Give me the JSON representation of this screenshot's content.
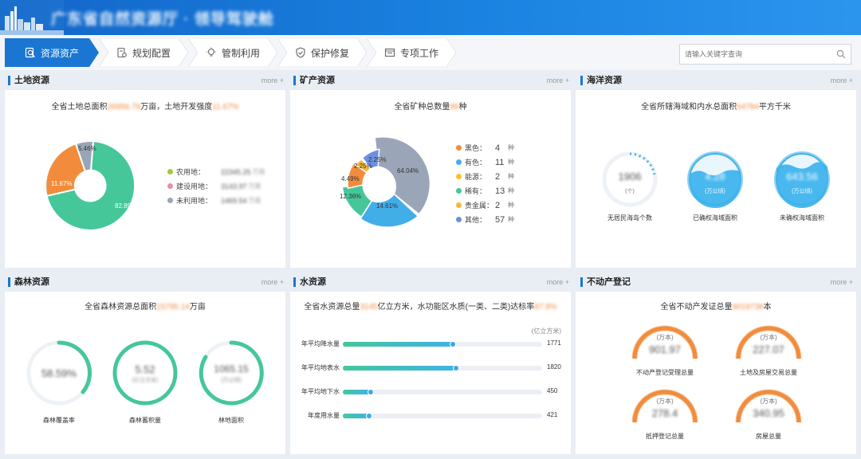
{
  "header": {
    "title": "广东省自然资源厅 · 领导驾驶舱"
  },
  "nav": {
    "tabs": [
      {
        "label": "资源资产",
        "icon": "search-doc-icon"
      },
      {
        "label": "规划配置",
        "icon": "plan-icon"
      },
      {
        "label": "管制利用",
        "icon": "bulb-icon"
      },
      {
        "label": "保护修复",
        "icon": "shield-icon"
      },
      {
        "label": "专项工作",
        "icon": "folder-icon"
      }
    ],
    "search_placeholder": "请输入关键字查询"
  },
  "more_label": "more +",
  "land": {
    "title": "土地资源",
    "summary_a": "全省土地总面积",
    "summary_v1": "26956.76",
    "summary_b": "万亩，土地开发强度",
    "summary_v2": "11.67%",
    "legend": [
      {
        "label": "农用地：",
        "value": "22345.25",
        "unit": "万亩",
        "color": "#9ccc3c"
      },
      {
        "label": "建设用地：",
        "value": "3143.97",
        "unit": "万亩",
        "color": "#e88fa0"
      },
      {
        "label": "未利用地：",
        "value": "1469.54",
        "unit": "万亩",
        "color": "#9aa5b8"
      }
    ],
    "pie_labels": [
      "82.89%",
      "11.67%",
      "5.46%"
    ]
  },
  "mineral": {
    "title": "矿产资源",
    "summary_a": "全省矿种总数量",
    "summary_v1": "89",
    "summary_b": "种",
    "legend": [
      {
        "label": "黑色：",
        "value": "4",
        "unit": "种",
        "color": "#f28c3c"
      },
      {
        "label": "有色：",
        "value": "11",
        "unit": "种",
        "color": "#42aee8"
      },
      {
        "label": "能源：",
        "value": "2",
        "unit": "种",
        "color": "#f6c22e"
      },
      {
        "label": "稀有：",
        "value": "13",
        "unit": "种",
        "color": "#45c79a"
      },
      {
        "label": "贵金属：",
        "value": "2",
        "unit": "种",
        "color": "#f3b83c"
      },
      {
        "label": "其他：",
        "value": "57",
        "unit": "种",
        "color": "#6c8fe0"
      }
    ],
    "pie_labels": [
      "64.04%",
      "14.61%",
      "12.36%",
      "4.49%",
      "2.25%",
      "2.25%"
    ]
  },
  "ocean": {
    "title": "海洋资源",
    "summary_a": "全省所辖海域和内水总面积",
    "summary_v1": "64784",
    "summary_b": "平方千米",
    "items": [
      {
        "value": "1906",
        "unit": "(个)",
        "caption": "无居民海岛个数"
      },
      {
        "value": "4.28",
        "unit": "(万公顷)",
        "caption": "已确权海域面积"
      },
      {
        "value": "643.56",
        "unit": "(万公顷)",
        "caption": "未确权海域面积"
      }
    ]
  },
  "forest": {
    "title": "森林资源",
    "summary_a": "全省森林资源总面积",
    "summary_v1": "15795.14",
    "summary_b": "万亩",
    "items": [
      {
        "value": "58.59%",
        "unit": "",
        "caption": "森林覆盖率"
      },
      {
        "value": "5.52",
        "unit": "(亿立方米)",
        "caption": "森林蓄积量"
      },
      {
        "value": "1065.15",
        "unit": "(万公顷)",
        "caption": "林地面积"
      }
    ]
  },
  "water": {
    "title": "水资源",
    "summary_a": "全省水资源总量",
    "summary_v1": "3145",
    "summary_b": "亿立方米，水功能区水质(一类、二类)达标率",
    "summary_v2": "87.9%",
    "unit_label": "(亿立方米)",
    "bars": [
      {
        "label": "年平均降水量",
        "value": 1771
      },
      {
        "label": "年平均地表水",
        "value": 1820
      },
      {
        "label": "年平均地下水",
        "value": 450
      },
      {
        "label": "年度用水量",
        "value": 421
      }
    ],
    "max": 3200
  },
  "estate": {
    "title": "不动产登记",
    "summary_a": "全省不动产发证总量",
    "summary_v1": "9019738",
    "summary_b": "本",
    "items": [
      {
        "unit": "(万本)",
        "value": "901.97",
        "caption": "不动产登记受理总量"
      },
      {
        "unit": "(万本)",
        "value": "227.07",
        "caption": "土地及房屋交易总量"
      },
      {
        "unit": "(万本)",
        "value": "278.4",
        "caption": "抵押登记总量"
      },
      {
        "unit": "(万本)",
        "value": "340.95",
        "caption": "房屋总量"
      }
    ]
  }
}
